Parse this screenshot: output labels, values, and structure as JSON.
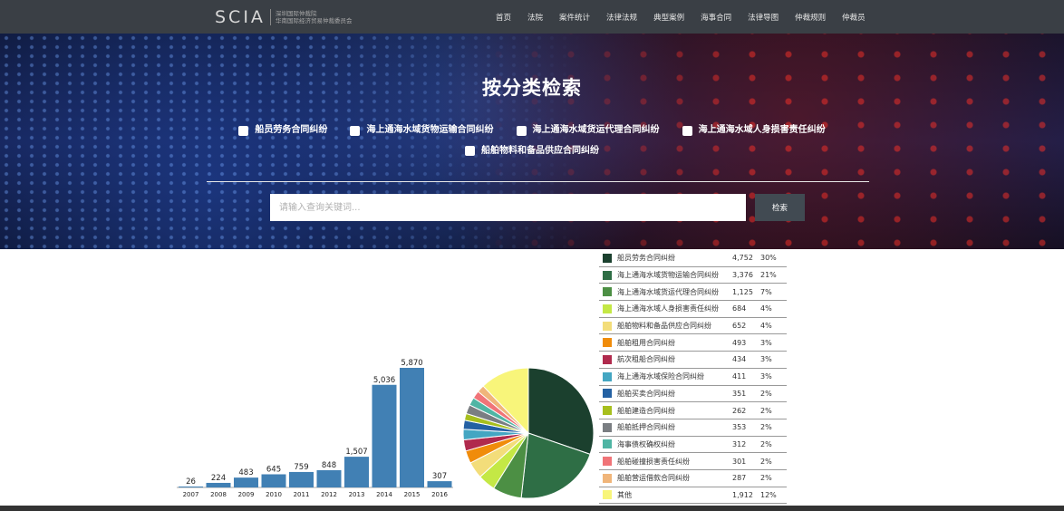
{
  "header": {
    "logo_text": "SCIA",
    "logo_sub_line1": "深圳国际仲裁院",
    "logo_sub_line2": "华南国际经济贸易仲裁委员会",
    "nav": [
      "首页",
      "法院",
      "案件统计",
      "法律法规",
      "典型案例",
      "海事合同",
      "法律导图",
      "仲裁规则",
      "仲裁员"
    ]
  },
  "hero": {
    "title": "按分类检索",
    "filters": [
      "船员劳务合同纠纷",
      "海上通海水域货物运输合同纠纷",
      "海上通海水域货运代理合同纠纷",
      "海上通海水域人身损害责任纠纷",
      "船舶物料和备品供应合同纠纷"
    ],
    "search": {
      "placeholder": "请输入查询关键词...",
      "button_label": "检索"
    }
  },
  "chart_data": [
    {
      "type": "bar",
      "categories": [
        "2007",
        "2008",
        "2009",
        "2010",
        "2011",
        "2012",
        "2013",
        "2014",
        "2015",
        "2016"
      ],
      "values": [
        26,
        224,
        483,
        645,
        759,
        848,
        1507,
        5036,
        5870,
        307
      ],
      "value_labels": [
        "26",
        "224",
        "483",
        "645",
        "759",
        "848",
        "1,507",
        "5,036",
        "5,870",
        "307"
      ],
      "color": "#4180b4",
      "title": "",
      "xlabel": "",
      "ylabel": ""
    },
    {
      "type": "pie",
      "slices": [
        {
          "label": "船员劳务合同纠纷",
          "value": 4752,
          "count": "4,752",
          "pct": "30%",
          "color": "#1b402e"
        },
        {
          "label": "海上通海水域货物运输合同纠纷",
          "value": 3376,
          "count": "3,376",
          "pct": "21%",
          "color": "#2e6e45"
        },
        {
          "label": "海上通海水域货运代理合同纠纷",
          "value": 1125,
          "count": "1,125",
          "pct": "7%",
          "color": "#4c8f44"
        },
        {
          "label": "海上通海水域人身损害责任纠纷",
          "value": 684,
          "count": "684",
          "pct": "4%",
          "color": "#c4e845"
        },
        {
          "label": "船舶物料和备品供应合同纠纷",
          "value": 652,
          "count": "652",
          "pct": "4%",
          "color": "#f3dd7a"
        },
        {
          "label": "船舶租用合同纠纷",
          "value": 493,
          "count": "493",
          "pct": "3%",
          "color": "#f08c0b"
        },
        {
          "label": "航次租船合同纠纷",
          "value": 434,
          "count": "434",
          "pct": "3%",
          "color": "#b02a4d"
        },
        {
          "label": "海上通海水域保险合同纠纷",
          "value": 411,
          "count": "411",
          "pct": "3%",
          "color": "#44a6c2"
        },
        {
          "label": "船舶买卖合同纠纷",
          "value": 351,
          "count": "351",
          "pct": "2%",
          "color": "#2461a3"
        },
        {
          "label": "船舶建造合同纠纷",
          "value": 262,
          "count": "262",
          "pct": "2%",
          "color": "#a7bf1e"
        },
        {
          "label": "船舶抵押合同纠纷",
          "value": 353,
          "count": "353",
          "pct": "2%",
          "color": "#7a7e82"
        },
        {
          "label": "海事债权确权纠纷",
          "value": 312,
          "count": "312",
          "pct": "2%",
          "color": "#50b5a4"
        },
        {
          "label": "船舶碰撞损害责任纠纷",
          "value": 301,
          "count": "301",
          "pct": "2%",
          "color": "#f07478"
        },
        {
          "label": "船舶营运借款合同纠纷",
          "value": 287,
          "count": "287",
          "pct": "2%",
          "color": "#f0b57a"
        },
        {
          "label": "其他",
          "value": 1912,
          "count": "1,912",
          "pct": "12%",
          "color": "#f8f57a"
        }
      ]
    }
  ]
}
